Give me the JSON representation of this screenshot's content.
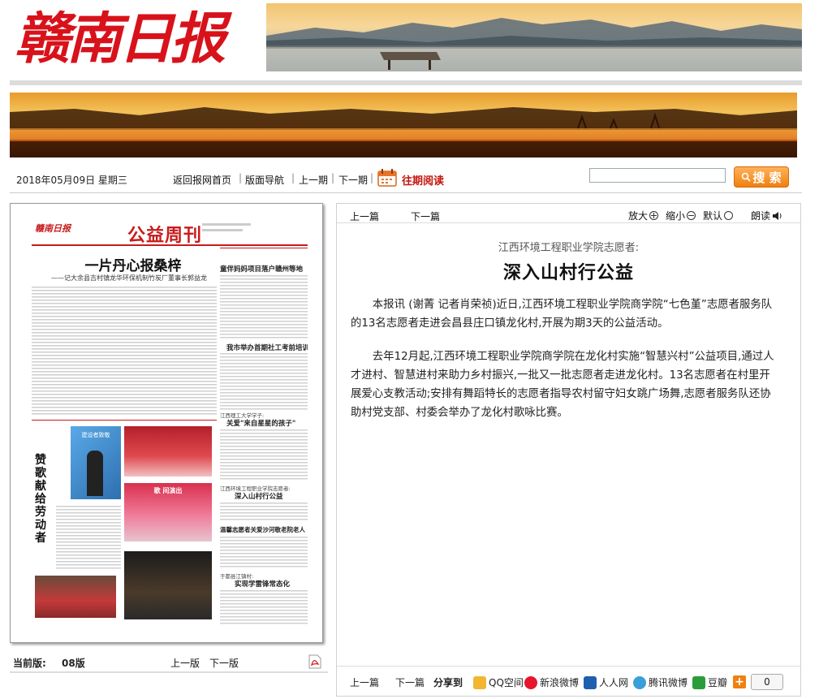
{
  "masthead": {
    "logo_text": "赣南日报"
  },
  "navbar": {
    "date": "2018年05月09日  星期三",
    "links": [
      "返回报网首页",
      "版面导航",
      "上一期",
      "下一期"
    ],
    "past_label": "往期阅读",
    "search_placeholder": "",
    "search_label": "搜 索"
  },
  "page_preview": {
    "masthead": "赣南日报",
    "section": "公益周刊",
    "lead_title": "一片丹心报桑梓",
    "lead_sub": "——记大余县吉村镇龙华环保机制竹炭厂董事长郭益龙",
    "side_headline1": "童伴妈妈项目落户赣州等地",
    "side_headline2": "我市举办首期社工考前培训",
    "side_kicker3": "江西理工大学学子:",
    "side_headline3": "关爱\"来自星星的孩子\"",
    "side_kicker4": "江西环境工程职业学院志愿者:",
    "side_headline4": "深入山村行公益",
    "side_headline5": "温馨志愿者关爱沙河敬老院老人",
    "side_kicker6": "于都县江镇村:",
    "side_headline6": "实现学雷锋常态化",
    "vertical_title": "赞歌献给劳动者",
    "photo_caption1": "建设者致敬",
    "photo_caption2": "歌  间演出"
  },
  "page_footer": {
    "current_label": "当前版:",
    "current_value": "08版",
    "prev": "上一版",
    "next": "下一版"
  },
  "article_toolbar": {
    "prev": "上一篇",
    "next": "下一篇",
    "zoom_in": "放大",
    "zoom_out": "缩小",
    "default": "默认",
    "read_aloud": "朗读"
  },
  "article": {
    "kicker": "江西环境工程职业学院志愿者:",
    "headline": "深入山村行公益",
    "paragraphs": [
      "本报讯 (谢菁 记者肖荣祯)近日,江西环境工程职业学院商学院“七色堇”志愿者服务队的13名志愿者走进会昌县庄口镇龙化村,开展为期3天的公益活动。",
      "去年12月起,江西环境工程职业学院商学院在龙化村实施“智慧兴村”公益项目,通过人才进村、智慧进村来助力乡村振兴,一批又一批志愿者走进龙化村。13名志愿者在村里开展爱心支教活动;安排有舞蹈特长的志愿者指导农村留守妇女跳广场舞,志愿者服务队还协助村党支部、村委会举办了龙化村歌咏比赛。"
    ]
  },
  "share_bar": {
    "prev": "上一篇",
    "next": "下一篇",
    "share_label": "分享到",
    "targets": [
      "QQ空间",
      "新浪微博",
      "人人网",
      "腾讯微博",
      "豆瓣"
    ],
    "count": "0"
  },
  "colors": {
    "brand_red": "#d8121b",
    "accent_orange": "#f08010"
  }
}
